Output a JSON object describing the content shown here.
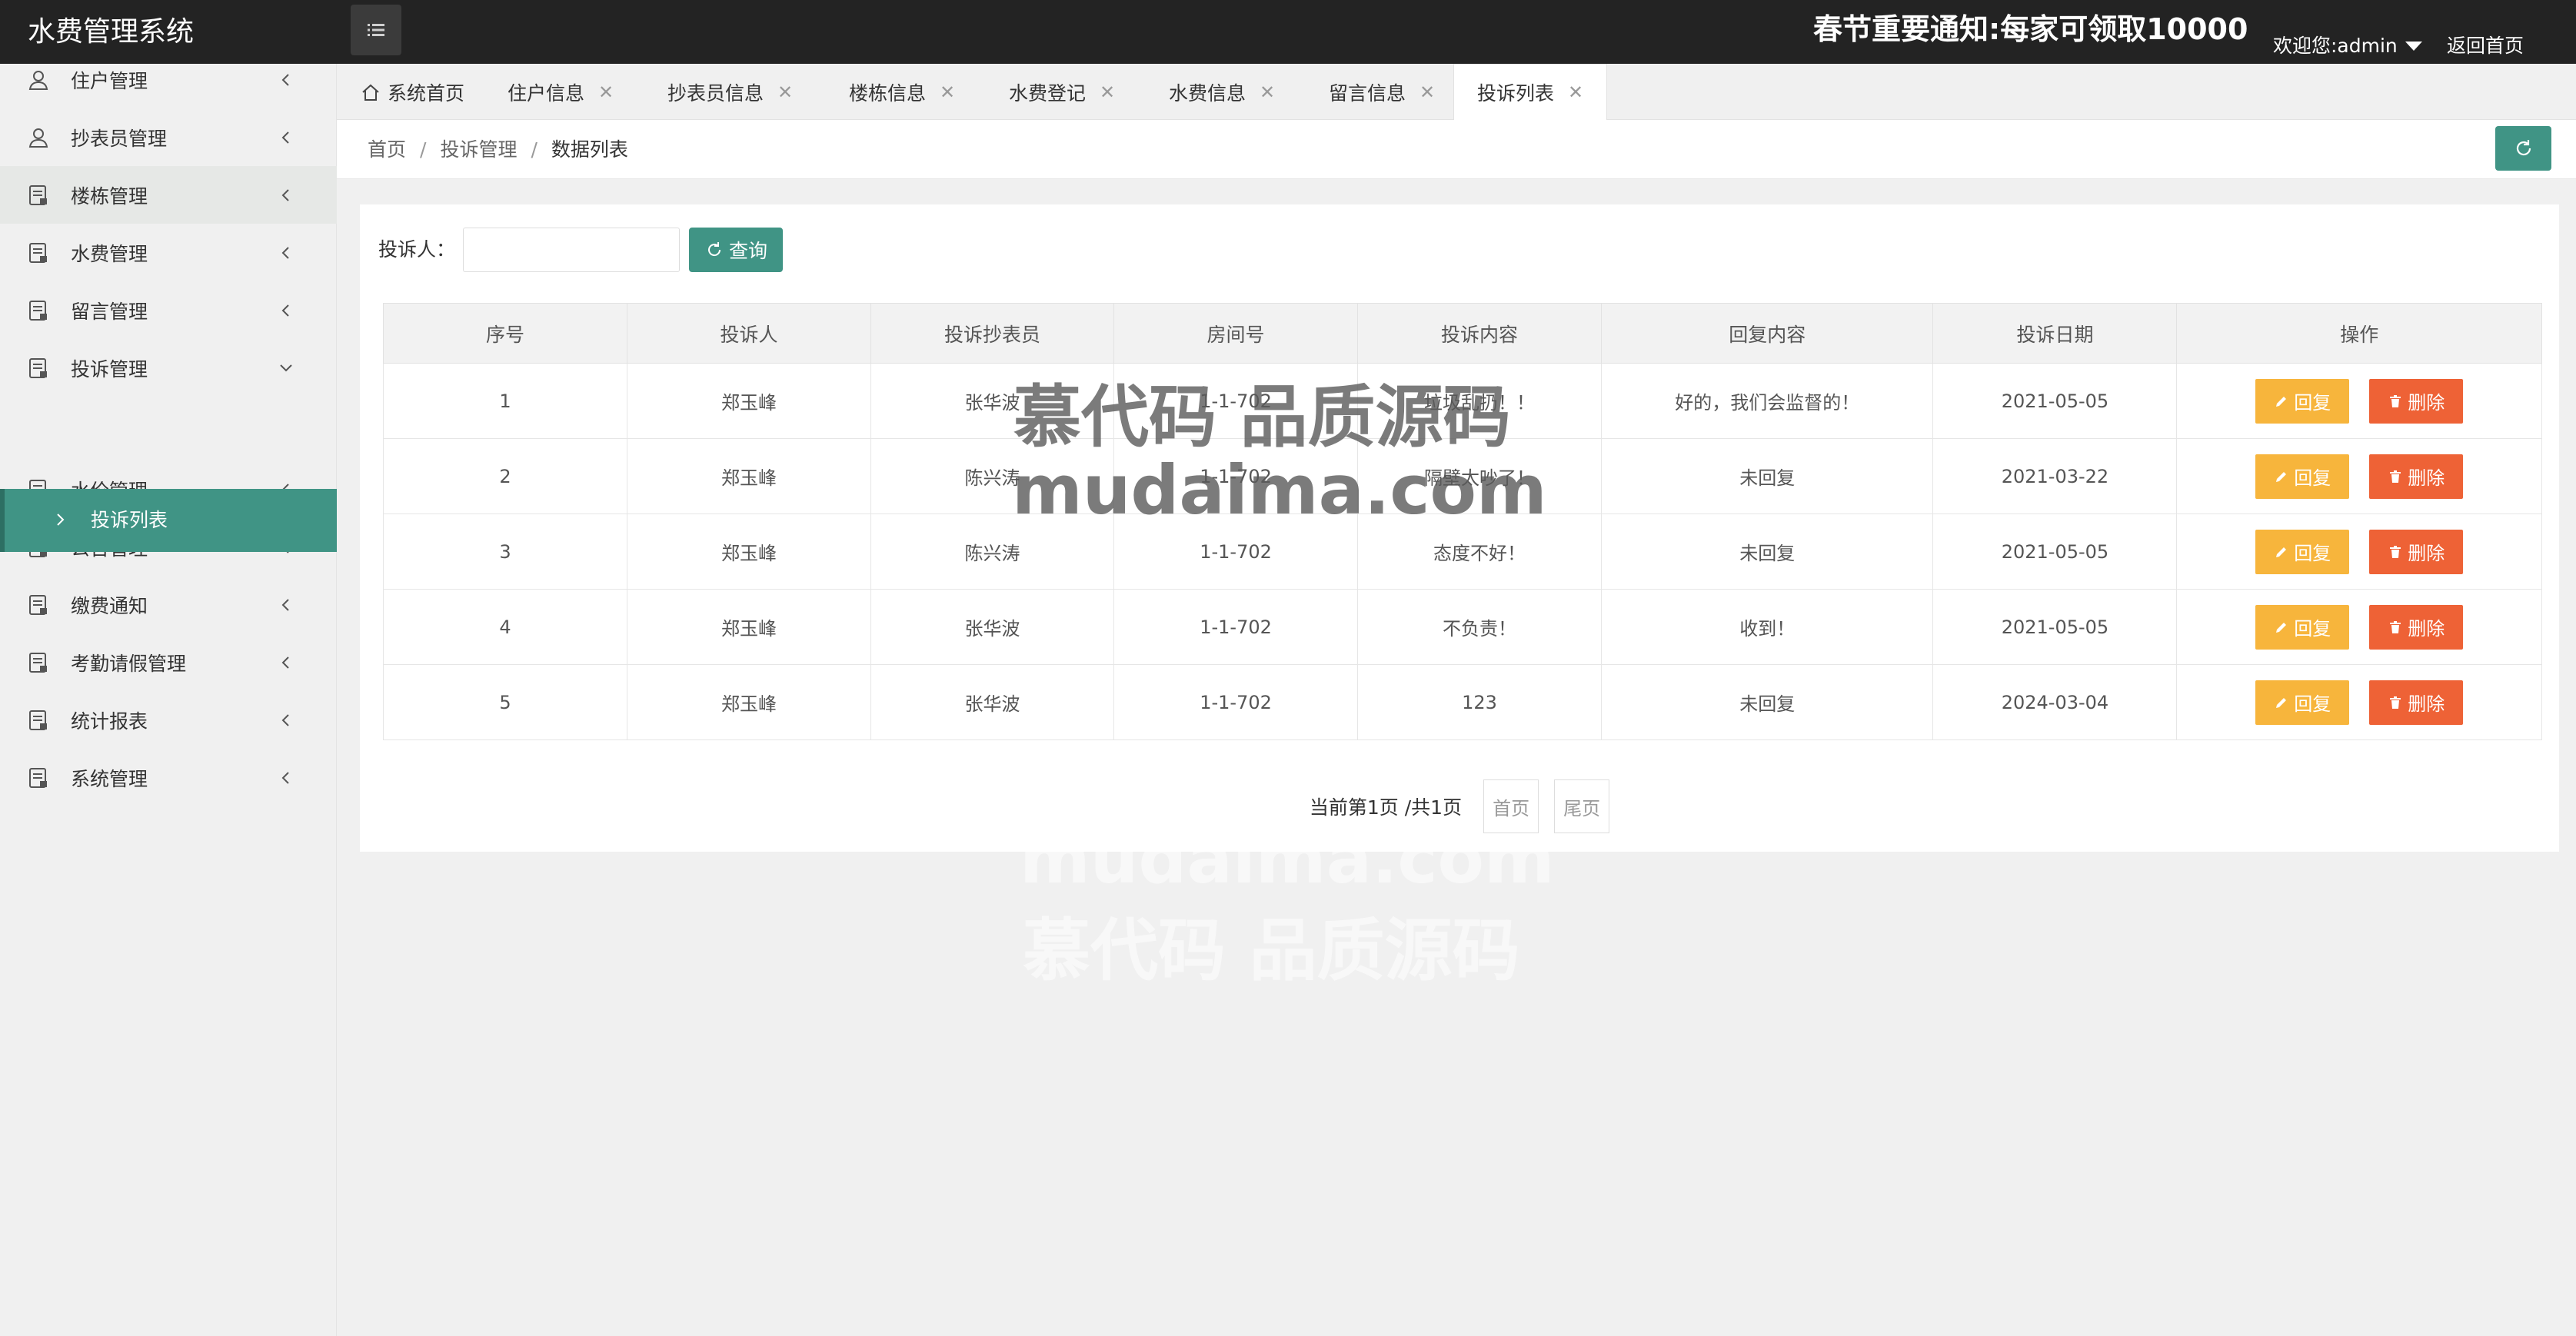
{
  "header": {
    "app_title": "水费管理系统",
    "notice": "春节重要通知:每家可领取10000",
    "welcome": "欢迎您:admin",
    "back_home": "返回首页"
  },
  "sidebar": {
    "items": [
      {
        "label": "住户管理",
        "icon": "user-icon"
      },
      {
        "label": "抄表员管理",
        "icon": "user-icon"
      },
      {
        "label": "楼栋管理",
        "icon": "doc-icon"
      },
      {
        "label": "水费管理",
        "icon": "doc-icon"
      },
      {
        "label": "留言管理",
        "icon": "doc-icon"
      },
      {
        "label": "投诉管理",
        "icon": "doc-icon",
        "expanded": true
      },
      {
        "label": "水价管理",
        "icon": "doc-icon"
      },
      {
        "label": "公告管理",
        "icon": "doc-icon"
      },
      {
        "label": "缴费通知",
        "icon": "doc-icon"
      },
      {
        "label": "考勤请假管理",
        "icon": "doc-icon"
      },
      {
        "label": "统计报表",
        "icon": "doc-icon"
      },
      {
        "label": "系统管理",
        "icon": "doc-icon"
      }
    ],
    "active_sub": "投诉列表"
  },
  "tabs": [
    {
      "label": "系统首页"
    },
    {
      "label": "住户信息"
    },
    {
      "label": "抄表员信息"
    },
    {
      "label": "楼栋信息"
    },
    {
      "label": "水费登记"
    },
    {
      "label": "水费信息"
    },
    {
      "label": "留言信息"
    },
    {
      "label": "投诉列表",
      "active": true
    }
  ],
  "tab_close_glyph": "✕",
  "breadcrumb": {
    "home": "首页",
    "section": "投诉管理",
    "current": "数据列表",
    "sep": "/"
  },
  "search": {
    "label": "投诉人：",
    "value": "",
    "button": "查询"
  },
  "table": {
    "headers": [
      "序号",
      "投诉人",
      "投诉抄表员",
      "房间号",
      "投诉内容",
      "回复内容",
      "投诉日期",
      "操作"
    ],
    "rows": [
      {
        "no": "1",
        "complainant": "郑玉峰",
        "reader": "张华波",
        "room": "1-1-702",
        "content": "垃圾乱扔！！",
        "reply": "好的，我们会监督的！",
        "date": "2021-05-05"
      },
      {
        "no": "2",
        "complainant": "郑玉峰",
        "reader": "陈兴涛",
        "room": "1-1-702",
        "content": "隔壁太吵了！",
        "reply": "未回复",
        "date": "2021-03-22"
      },
      {
        "no": "3",
        "complainant": "郑玉峰",
        "reader": "陈兴涛",
        "room": "1-1-702",
        "content": "态度不好！",
        "reply": "未回复",
        "date": "2021-05-05"
      },
      {
        "no": "4",
        "complainant": "郑玉峰",
        "reader": "张华波",
        "room": "1-1-702",
        "content": "不负责！",
        "reply": "收到！",
        "date": "2021-05-05"
      },
      {
        "no": "5",
        "complainant": "郑玉峰",
        "reader": "张华波",
        "room": "1-1-702",
        "content": "123",
        "reply": "未回复",
        "date": "2024-03-04"
      }
    ],
    "reply_label": "回复",
    "delete_label": "删除"
  },
  "pager": {
    "info": "当前第1页 /共1页",
    "first": "首页",
    "last": "尾页"
  },
  "watermark": {
    "cn": "慕代码 品质源码",
    "en": "mudaima.com"
  },
  "colors": {
    "header_bg": "#232323",
    "primary": "#409485",
    "warning": "#f7b53c",
    "danger": "#ee6236"
  }
}
